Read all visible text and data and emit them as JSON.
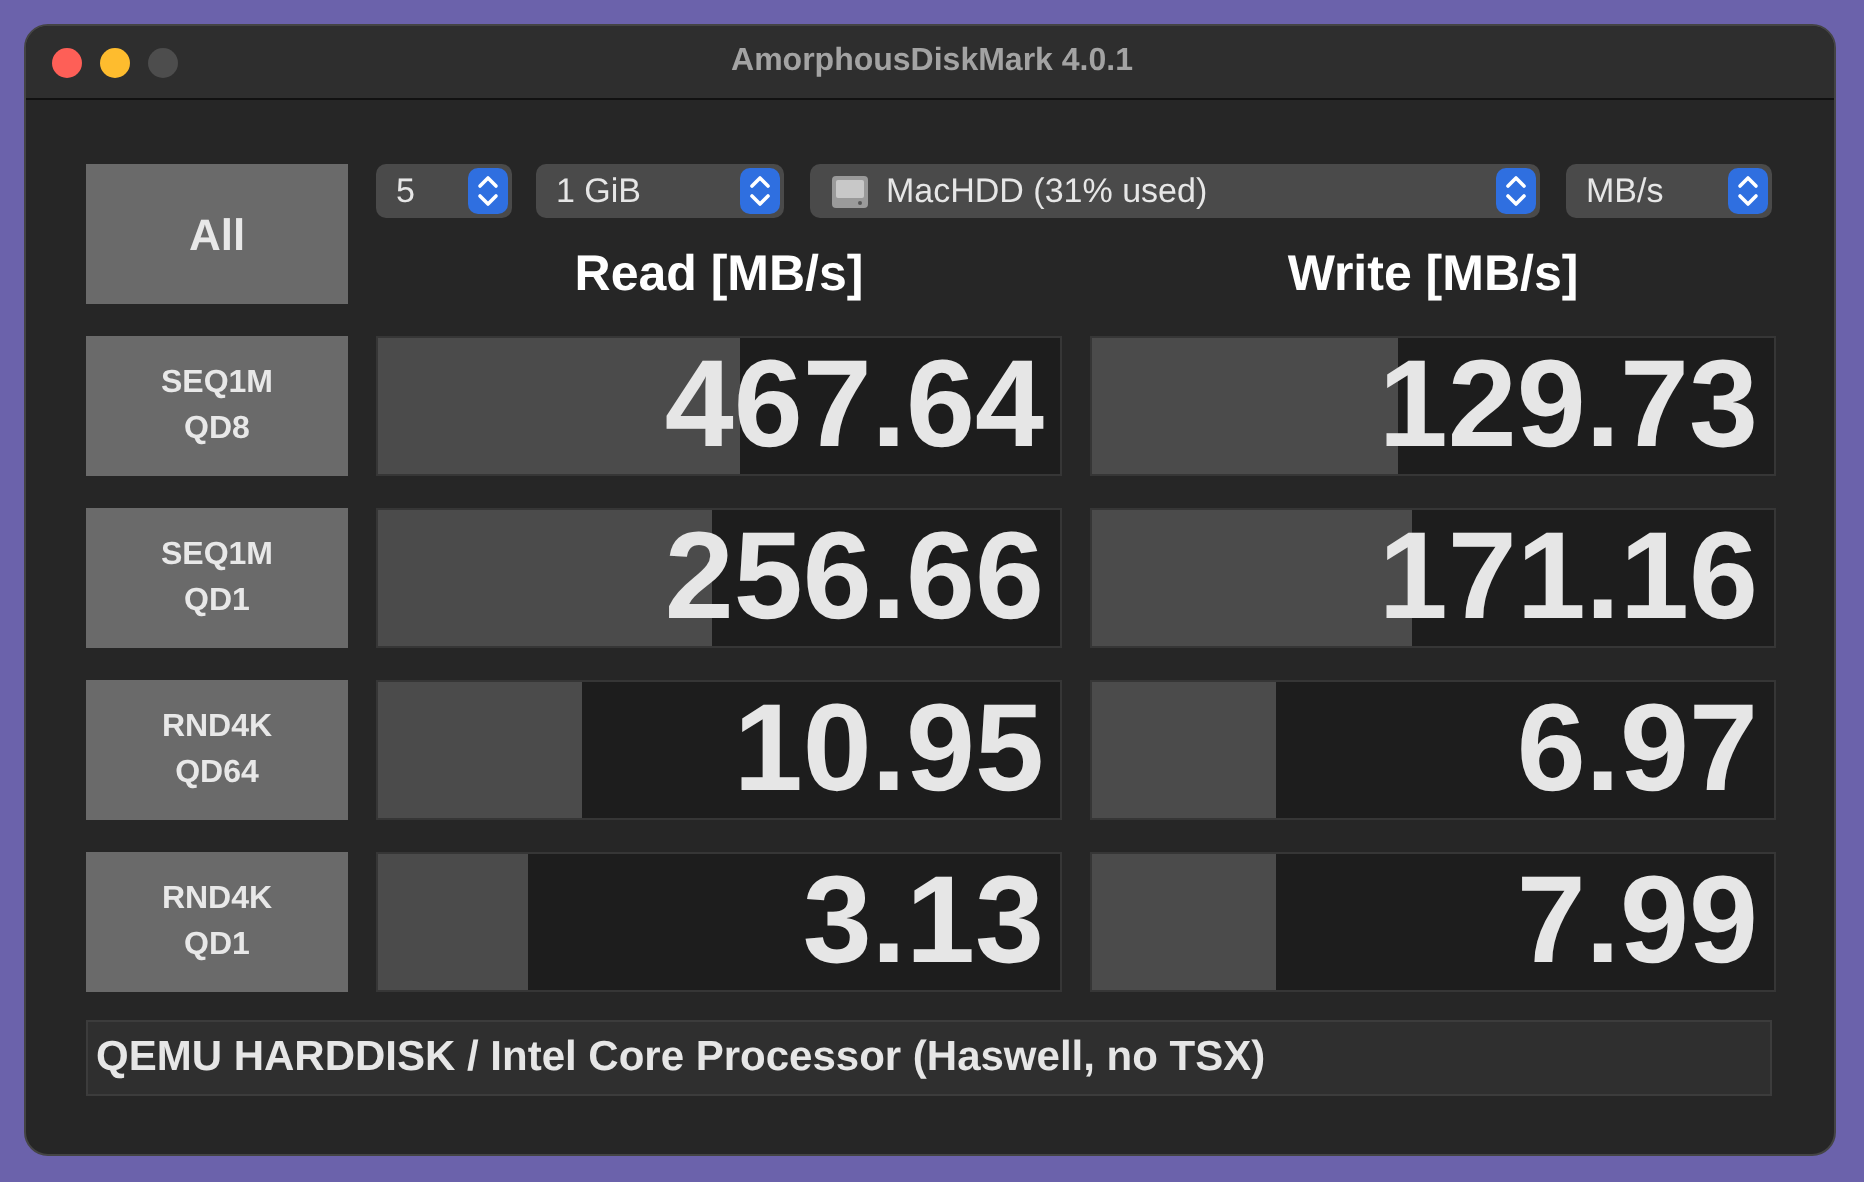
{
  "window": {
    "title": "AmorphousDiskMark 4.0.1"
  },
  "all_button": "All",
  "selects": [
    {
      "kind": "count",
      "value": "5"
    },
    {
      "kind": "size",
      "value": "1 GiB"
    },
    {
      "kind": "drive",
      "value": "MacHDD (31% used)"
    },
    {
      "kind": "unit",
      "value": "MB/s"
    }
  ],
  "columns": [
    "Read [MB/s]",
    "Write [MB/s]"
  ],
  "rows": [
    {
      "label": [
        "SEQ1M",
        "QD8"
      ],
      "read": {
        "value": "467.64",
        "level": 0.53
      },
      "write": {
        "value": "129.73",
        "level": 0.45
      }
    },
    {
      "label": [
        "SEQ1M",
        "QD1"
      ],
      "read": {
        "value": "256.66",
        "level": 0.49
      },
      "write": {
        "value": "171.16",
        "level": 0.47
      }
    },
    {
      "label": [
        "RND4K",
        "QD64"
      ],
      "read": {
        "value": "10.95",
        "level": 0.3
      },
      "write": {
        "value": "6.97",
        "level": 0.27
      }
    },
    {
      "label": [
        "RND4K",
        "QD1"
      ],
      "read": {
        "value": "3.13",
        "level": 0.22
      },
      "write": {
        "value": "7.99",
        "level": 0.27
      }
    }
  ],
  "comment": "QEMU HARDDISK / Intel Core Processor (Haswell, no TSX)"
}
